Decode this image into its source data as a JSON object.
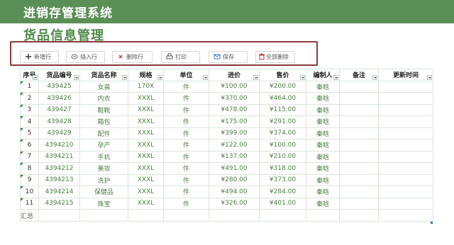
{
  "app": {
    "title": "进销存管理系统",
    "page_title": "货品信息管理"
  },
  "colors": {
    "header_bar": "#5a8f55",
    "accent": "#4f8a4a",
    "toolbar_border": "#8c3a3a"
  },
  "toolbar": {
    "buttons": [
      {
        "label": "新增行",
        "icon": "plus-icon"
      },
      {
        "label": "插入行",
        "icon": "insert-row-icon"
      },
      {
        "label": "删除行",
        "icon": "close-icon"
      },
      {
        "label": "打印",
        "icon": "printer-icon"
      },
      {
        "label": "保存",
        "icon": "save-icon"
      },
      {
        "label": "全部删除",
        "icon": "delete-all-icon"
      }
    ]
  },
  "table": {
    "headers": [
      "序号",
      "货品编号",
      "货品名称",
      "规格",
      "单位",
      "进价",
      "售价",
      "编制人",
      "备注",
      "更新时间"
    ],
    "rows": [
      [
        "1",
        "439425",
        "女装",
        "170X",
        "件",
        "¥100.00",
        "¥200.00",
        "秦晗",
        "",
        ""
      ],
      [
        "2",
        "439426",
        "内衣",
        "XXXL",
        "件",
        "¥370.00",
        "¥464.00",
        "秦晗",
        "",
        ""
      ],
      [
        "3",
        "439427",
        "鞋靴",
        "XXXL",
        "件",
        "¥478.00",
        "¥115.00",
        "秦晗",
        "",
        ""
      ],
      [
        "4",
        "439428",
        "箱包",
        "XXXL",
        "件",
        "¥175.00",
        "¥291.00",
        "秦晗",
        "",
        ""
      ],
      [
        "5",
        "439429",
        "配件",
        "XXXL",
        "件",
        "¥399.00",
        "¥374.00",
        "秦晗",
        "",
        ""
      ],
      [
        "6",
        "4394210",
        "孕产",
        "XXXL",
        "件",
        "¥122.00",
        "¥100.00",
        "秦晗",
        "",
        ""
      ],
      [
        "7",
        "4394211",
        "手机",
        "XXXL",
        "件",
        "¥137.00",
        "¥210.00",
        "秦晗",
        "",
        ""
      ],
      [
        "8",
        "4394212",
        "美妆",
        "XXXL",
        "件",
        "¥491.00",
        "¥318.00",
        "秦晗",
        "",
        ""
      ],
      [
        "9",
        "4394213",
        "洗护",
        "XXXL",
        "件",
        "¥280.00",
        "¥373.00",
        "秦晗",
        "",
        ""
      ],
      [
        "10",
        "4394214",
        "保健品",
        "XXXL",
        "件",
        "¥494.00",
        "¥284.00",
        "秦晗",
        "",
        ""
      ],
      [
        "11",
        "4394215",
        "珠宝",
        "XXXL",
        "件",
        "¥326.00",
        "¥401.00",
        "秦晗",
        "",
        ""
      ]
    ],
    "summary_label": "汇总"
  }
}
